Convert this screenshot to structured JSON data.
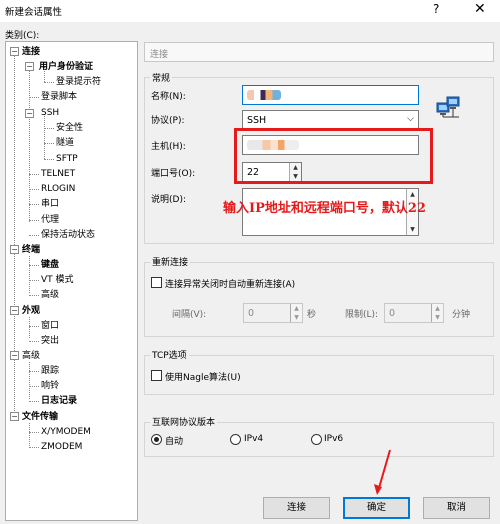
{
  "window": {
    "title": "新建会话属性",
    "help_glyph": "?",
    "close_glyph": "✕"
  },
  "category_label": "类别(C):",
  "tree": {
    "connection": "连接",
    "auth": "用户身份验证",
    "login_prompt": "登录提示符",
    "login_script": "登录脚本",
    "ssh": "SSH",
    "security": "安全性",
    "tunnel": "隧道",
    "sftp": "SFTP",
    "telnet": "TELNET",
    "rlogin": "RLOGIN",
    "serial": "串口",
    "proxy": "代理",
    "keepalive": "保持活动状态",
    "terminal": "终端",
    "keyboard": "键盘",
    "vt_mode": "VT 模式",
    "advanced_t": "高级",
    "appearance": "外观",
    "window_item": "窗口",
    "highlight": "突出",
    "advanced": "高级",
    "trace": "跟踪",
    "bell": "响铃",
    "logging": "日志记录",
    "file_transfer": "文件传输",
    "xymodem": "X/YMODEM",
    "zmodem": "ZMODEM"
  },
  "panel_header": "连接",
  "general": {
    "title": "常规",
    "name_label": "名称(N):",
    "protocol_label": "协议(P):",
    "protocol_value": "SSH",
    "host_label": "主机(H):",
    "port_label": "端口号(O):",
    "port_value": "22",
    "desc_label": "说明(D):"
  },
  "annotation": "输入IP地址和远程端口号，默认22",
  "reconnect": {
    "title": "重新连接",
    "checkbox_label": "连接异常关闭时自动重新连接(A)",
    "interval_label": "间隔(V):",
    "interval_value": "0",
    "interval_unit": "秒",
    "limit_label": "限制(L):",
    "limit_value": "0",
    "limit_unit": "分钟"
  },
  "tcp": {
    "title": "TCP选项",
    "nagle_label": "使用Nagle算法(U)"
  },
  "ip_version": {
    "title": "互联网协议版本",
    "options": [
      "自动",
      "IPv4",
      "IPv6"
    ],
    "selected": "自动"
  },
  "buttons": {
    "connect": "连接",
    "ok": "确定",
    "cancel": "取消"
  },
  "colors": {
    "annotation_red": "#e51a1a",
    "accent_blue": "#0078d7"
  }
}
